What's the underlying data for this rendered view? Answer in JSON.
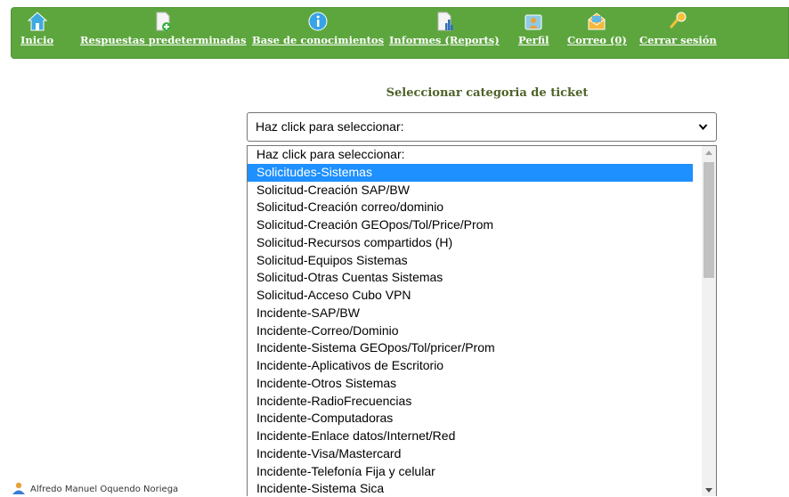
{
  "nav": {
    "items": [
      {
        "label": "Inicio",
        "icon": "home-icon"
      },
      {
        "label": "Respuestas predeterminadas",
        "icon": "add-document-icon"
      },
      {
        "label": "Base de conocimientos",
        "icon": "info-icon"
      },
      {
        "label": "Informes (Reports)",
        "icon": "report-chart-icon"
      },
      {
        "label": "Perfil",
        "icon": "profile-icon"
      },
      {
        "label": "Correo (0)",
        "icon": "mail-icon"
      },
      {
        "label": "Cerrar sesión",
        "icon": "key-icon"
      }
    ]
  },
  "main": {
    "title": "Seleccionar categoria de ticket",
    "select": {
      "value": "Haz click para seleccionar:",
      "options": [
        "Haz click para seleccionar:",
        "Solicitudes-Sistemas",
        "Solicitud-Creación SAP/BW",
        "Solicitud-Creación correo/dominio",
        "Solicitud-Creación GEOpos/Tol/Price/Prom",
        "Solicitud-Recursos compartidos (H)",
        "Solicitud-Equipos Sistemas",
        "Solicitud-Otras Cuentas Sistemas",
        "Solicitud-Acceso Cubo VPN",
        "Incidente-SAP/BW",
        "Incidente-Correo/Dominio",
        "Incidente-Sistema GEOpos/Tol/pricer/Prom",
        "Incidente-Aplicativos de Escritorio",
        "Incidente-Otros Sistemas",
        "Incidente-RadioFrecuencias",
        "Incidente-Computadoras",
        "Incidente-Enlace datos/Internet/Red",
        "Incidente-Visa/Mastercard",
        "Incidente-Telefonía Fija y celular",
        "Incidente-Sistema Sica"
      ],
      "highlighted_index": 1
    }
  },
  "footer": {
    "user": "Alfredo Manuel Oquendo Noriega"
  },
  "colors": {
    "nav_bg": "#5da63e",
    "title": "#4f6228",
    "highlight": "#1e90ff"
  }
}
